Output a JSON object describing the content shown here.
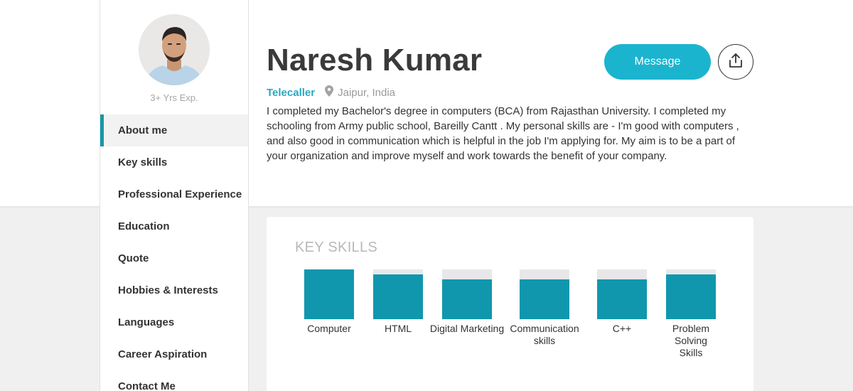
{
  "profile": {
    "name": "Naresh Kumar",
    "role": "Telecaller",
    "location": "Jaipur, India",
    "experience": "3+ Yrs Exp.",
    "about": "I completed my Bachelor's degree in computers (BCA) from Rajasthan University. I completed my schooling from Army public school, Bareilly Cantt . My personal skills are - I'm good with computers , and also good in communication which is helpful in the job I'm applying for. My aim is to be a part of your organization and improve myself and work towards the benefit of your company."
  },
  "actions": {
    "message_label": "Message",
    "share_icon": "share-upload-icon",
    "location_icon": "map-pin-icon"
  },
  "sidebar": {
    "items": [
      {
        "label": "About me",
        "active": true
      },
      {
        "label": "Key skills"
      },
      {
        "label": "Professional Experience"
      },
      {
        "label": "Education"
      },
      {
        "label": "Quote"
      },
      {
        "label": "Hobbies & Interests"
      },
      {
        "label": "Languages"
      },
      {
        "label": "Career Aspiration"
      },
      {
        "label": "Contact Me"
      }
    ]
  },
  "skills": {
    "title": "KEY SKILLS",
    "items": [
      {
        "label": "Computer",
        "level": 1.0
      },
      {
        "label": "HTML",
        "level": 0.9
      },
      {
        "label": "Digital Marketing",
        "level": 0.8
      },
      {
        "label": "Communication skills",
        "level": 0.8
      },
      {
        "label": "C++",
        "level": 0.8
      },
      {
        "label": "Problem Solving Skills",
        "level": 0.9
      }
    ]
  },
  "colors": {
    "accent": "#1bb4cf",
    "role_text": "#29a8c0",
    "skill_fill": "#1097ad",
    "skill_track": "#e8e8ea",
    "active_border": "#1497a9"
  }
}
